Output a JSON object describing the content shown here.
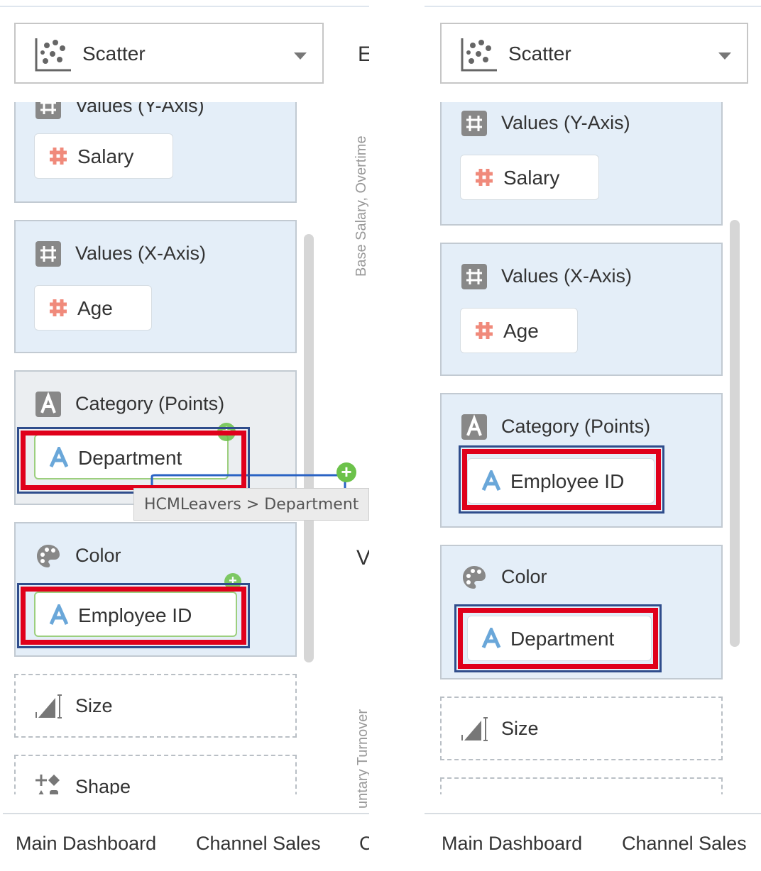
{
  "colors": {
    "section_bg": "#e4eef8",
    "section_gray_bg": "#ebeef1",
    "highlight_red": "#e0001b",
    "highlight_blue": "#2f4d8c",
    "hash_icon": "#f08a7b",
    "text_icon": "#6aa7d9",
    "plus_green": "#6cc24a"
  },
  "left": {
    "chart_type": "Scatter",
    "sections": {
      "y_axis": {
        "label": "Values (Y-Axis)",
        "pill": "Salary",
        "icon": "hash-icon"
      },
      "x_axis": {
        "label": "Values (X-Axis)",
        "pill": "Age",
        "icon": "hash-icon"
      },
      "category": {
        "label": "Category (Points)",
        "pill": "Department",
        "icon": "text-a-icon"
      },
      "color": {
        "label": "Color",
        "pill": "Employee ID",
        "icon": "palette-icon"
      },
      "size": {
        "label": "Size",
        "icon": "size-icon"
      },
      "shape": {
        "label": "Shape",
        "icon": "shape-icon"
      }
    },
    "tooltip": "HCMLeavers > Department",
    "canvas_partial": {
      "title_char": "E",
      "vertical_label": "Base Salary, Overtime",
      "second_char": "V",
      "lower_vertical_label": "untary Turnover"
    },
    "tabs": [
      "Main Dashboard",
      "Channel Sales",
      "C"
    ]
  },
  "right": {
    "chart_type": "Scatter",
    "sections": {
      "y_axis": {
        "label": "Values (Y-Axis)",
        "pill": "Salary"
      },
      "x_axis": {
        "label": "Values (X-Axis)",
        "pill": "Age"
      },
      "category": {
        "label": "Category (Points)",
        "pill": "Employee ID"
      },
      "color": {
        "label": "Color",
        "pill": "Department"
      },
      "size": {
        "label": "Size"
      }
    },
    "tabs": [
      "Main Dashboard",
      "Channel Sales"
    ]
  }
}
